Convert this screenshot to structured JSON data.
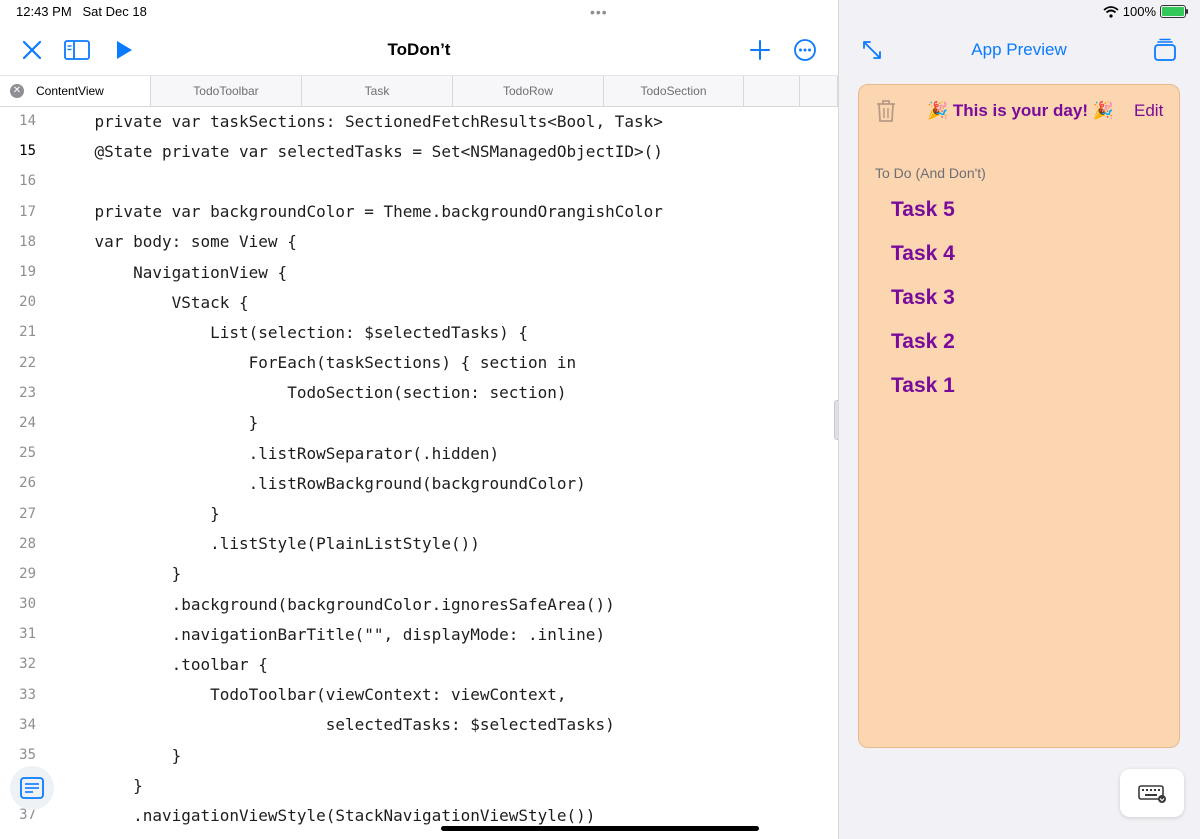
{
  "status": {
    "time": "12:43 PM",
    "date": "Sat Dec 18",
    "battery": "100%",
    "battery_level": 1.0
  },
  "toolbar": {
    "title": "ToDon’t"
  },
  "tabs": [
    {
      "label": "ContentView",
      "active": true
    },
    {
      "label": "TodoToolbar"
    },
    {
      "label": "Task"
    },
    {
      "label": "TodoRow"
    },
    {
      "label": "TodoSection"
    },
    {
      "label": ""
    },
    {
      "label": ""
    }
  ],
  "code": {
    "lines": [
      {
        "n": "14",
        "t": "    private var taskSections: SectionedFetchResults<Bool, Task>"
      },
      {
        "n": "15",
        "t": "    @State private var selectedTasks = Set<NSManagedObjectID>()"
      },
      {
        "n": "16",
        "t": ""
      },
      {
        "n": "17",
        "t": "    private var backgroundColor = Theme.backgroundOrangishColor"
      },
      {
        "n": "18",
        "t": "    var body: some View {"
      },
      {
        "n": "19",
        "t": "        NavigationView {"
      },
      {
        "n": "20",
        "t": "            VStack {"
      },
      {
        "n": "21",
        "t": "                List(selection: $selectedTasks) {"
      },
      {
        "n": "22",
        "t": "                    ForEach(taskSections) { section in"
      },
      {
        "n": "23",
        "t": "                        TodoSection(section: section)"
      },
      {
        "n": "24",
        "t": "                    }"
      },
      {
        "n": "25",
        "t": "                    .listRowSeparator(.hidden)"
      },
      {
        "n": "26",
        "t": "                    .listRowBackground(backgroundColor)"
      },
      {
        "n": "27",
        "t": "                }"
      },
      {
        "n": "28",
        "t": "                .listStyle(PlainListStyle())"
      },
      {
        "n": "29",
        "t": "            }"
      },
      {
        "n": "30",
        "t": "            .background(backgroundColor.ignoresSafeArea())"
      },
      {
        "n": "31",
        "t": "            .navigationBarTitle(\"\", displayMode: .inline)"
      },
      {
        "n": "32",
        "t": "            .toolbar {"
      },
      {
        "n": "33",
        "t": "                TodoToolbar(viewContext: viewContext,"
      },
      {
        "n": "34",
        "t": "                            selectedTasks: $selectedTasks)"
      },
      {
        "n": "35",
        "t": "            }"
      },
      {
        "n": "36",
        "t": "        }"
      },
      {
        "n": "37",
        "t": "        .navigationViewStyle(StackNavigationViewStyle())"
      }
    ]
  },
  "preview": {
    "title": "App Preview",
    "card": {
      "header": "🎉 This is your day! 🎉",
      "edit": "Edit",
      "section": "To Do (And Don't)",
      "tasks": [
        "Task 5",
        "Task 4",
        "Task 3",
        "Task 2",
        "Task 1"
      ]
    }
  },
  "colors": {
    "accent": "#0a7aff",
    "card_bg": "#fcd6b0",
    "task_purple": "#7a0a9b"
  }
}
